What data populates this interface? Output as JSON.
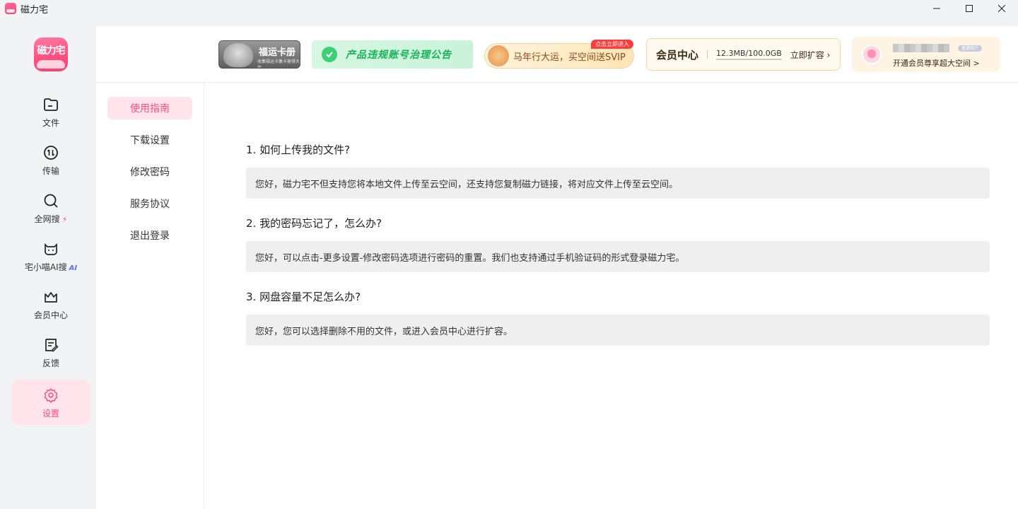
{
  "window": {
    "title": "磁力宅"
  },
  "logo": {
    "text": "磁力宅"
  },
  "nav": {
    "items": [
      {
        "label": "文件",
        "icon": "folder-icon"
      },
      {
        "label": "传输",
        "icon": "transfer-icon"
      },
      {
        "label": "全网搜",
        "icon": "search-icon",
        "badge": "⚡"
      },
      {
        "label": "宅小喵AI搜",
        "icon": "cat-icon",
        "badge": "AI"
      },
      {
        "label": "会员中心",
        "icon": "crown-icon"
      },
      {
        "label": "反馈",
        "icon": "feedback-icon"
      },
      {
        "label": "设置",
        "icon": "gear-icon",
        "active": true
      }
    ]
  },
  "banners": {
    "fuyun": {
      "title": "福运卡册",
      "subtitle": "收集福运卡集卡册得大奖"
    },
    "notice": {
      "text": "产品违规账号治理公告"
    },
    "promo": {
      "text": "马年行大运，买空间送SVIP",
      "tag": "点击立即进入"
    },
    "vip": {
      "title": "会员中心",
      "storage": "12.3MB/100.0GB",
      "expand": "立即扩容 ›"
    },
    "user": {
      "badge": "普通用户",
      "upgrade": "开通会员尊享超大空间 >"
    }
  },
  "subnav": {
    "items": [
      "使用指南",
      "下载设置",
      "修改密码",
      "服务协议",
      "退出登录"
    ],
    "active_index": 0
  },
  "faq": [
    {
      "q": "1. 如何上传我的文件?",
      "a": "您好，磁力宅不但支持您将本地文件上传至云空间，还支持您复制磁力链接，将对应文件上传至云空间。"
    },
    {
      "q": "2. 我的密码忘记了，怎么办?",
      "a": "您好，可以点击-更多设置-修改密码选项进行密码的重置。我们也支持通过手机验证码的形式登录磁力宅。"
    },
    {
      "q": "3. 网盘容量不足怎么办?",
      "a": "您好，您可以选择删除不用的文件，或进入会员中心进行扩容。"
    }
  ],
  "colors": {
    "accent": "#ff4d7e",
    "active_bg": "#ffe4ec",
    "notice_green": "#18b157"
  }
}
